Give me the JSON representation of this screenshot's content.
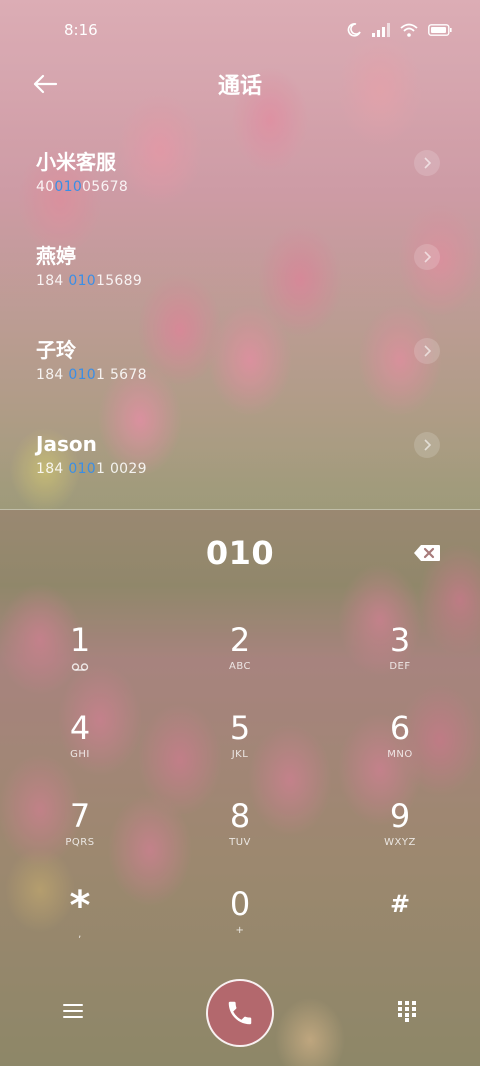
{
  "status_bar": {
    "time": "8:16",
    "icons": [
      "moon-icon",
      "signal-icon",
      "wifi-icon",
      "battery-icon"
    ]
  },
  "header": {
    "title": "通话",
    "back_icon": "back-arrow-icon"
  },
  "results": [
    {
      "name": "小米客服",
      "number_prefix": "40",
      "number_match": "010",
      "number_suffix": "05678"
    },
    {
      "name": "燕婷",
      "number_prefix": "184 ",
      "number_match": "010",
      "number_suffix": "15689"
    },
    {
      "name": "子玲",
      "number_prefix": "184 ",
      "number_match": "010",
      "number_suffix": "1 5678"
    },
    {
      "name": "Jason",
      "number_prefix": "184 ",
      "number_match": "010",
      "number_suffix": "1 0029"
    }
  ],
  "dialer": {
    "dialed_number": "010",
    "keys": [
      {
        "digit": "1",
        "sub": ""
      },
      {
        "digit": "2",
        "sub": "ABC"
      },
      {
        "digit": "3",
        "sub": "DEF"
      },
      {
        "digit": "4",
        "sub": "GHI"
      },
      {
        "digit": "5",
        "sub": "JKL"
      },
      {
        "digit": "6",
        "sub": "MNO"
      },
      {
        "digit": "7",
        "sub": "PQRS"
      },
      {
        "digit": "8",
        "sub": "TUV"
      },
      {
        "digit": "9",
        "sub": "WXYZ"
      },
      {
        "digit": "*",
        "sub": ","
      },
      {
        "digit": "0",
        "sub": "+"
      },
      {
        "digit": "#",
        "sub": ""
      }
    ]
  },
  "colors": {
    "match_highlight": "#3a8ee6",
    "call_button": "#b3686d"
  }
}
